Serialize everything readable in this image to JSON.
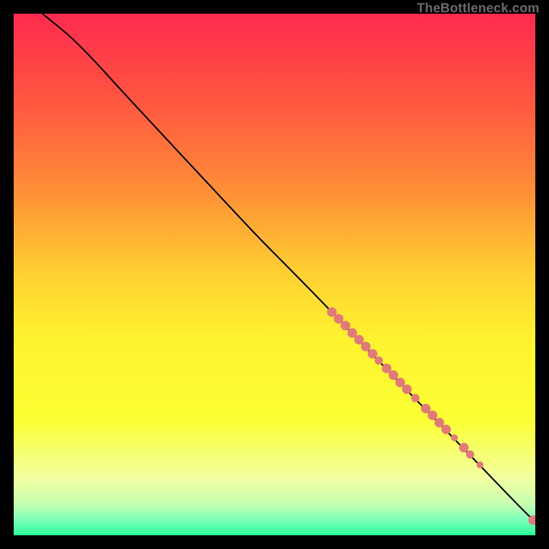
{
  "attribution": "TheBottleneck.com",
  "chart_data": {
    "type": "line",
    "title": "",
    "xlabel": "",
    "ylabel": "",
    "xlim": [
      0,
      1
    ],
    "ylim": [
      0,
      1
    ],
    "background": {
      "type": "vertical-gradient",
      "stops": [
        {
          "pos": 0.0,
          "color": "#ff2a4f"
        },
        {
          "pos": 0.17,
          "color": "#ff5740"
        },
        {
          "pos": 0.34,
          "color": "#ff8f36"
        },
        {
          "pos": 0.5,
          "color": "#ffd131"
        },
        {
          "pos": 0.62,
          "color": "#fff22f"
        },
        {
          "pos": 0.78,
          "color": "#fbff33"
        },
        {
          "pos": 0.89,
          "color": "#f2ffa0"
        },
        {
          "pos": 0.94,
          "color": "#c6ffb0"
        },
        {
          "pos": 0.97,
          "color": "#7dffb9"
        },
        {
          "pos": 1.0,
          "color": "#2cff9a"
        }
      ]
    },
    "curve": [
      {
        "x": 0.055,
        "y": 1.0
      },
      {
        "x": 0.08,
        "y": 0.98
      },
      {
        "x": 0.11,
        "y": 0.955
      },
      {
        "x": 0.15,
        "y": 0.915
      },
      {
        "x": 0.2,
        "y": 0.86
      },
      {
        "x": 0.26,
        "y": 0.795
      },
      {
        "x": 0.33,
        "y": 0.72
      },
      {
        "x": 0.4,
        "y": 0.645
      },
      {
        "x": 0.47,
        "y": 0.57
      },
      {
        "x": 0.54,
        "y": 0.5
      },
      {
        "x": 0.61,
        "y": 0.428
      },
      {
        "x": 0.68,
        "y": 0.355
      },
      {
        "x": 0.75,
        "y": 0.282
      },
      {
        "x": 0.82,
        "y": 0.21
      },
      {
        "x": 0.89,
        "y": 0.138
      },
      {
        "x": 0.96,
        "y": 0.065
      },
      {
        "x": 1.0,
        "y": 0.025
      }
    ],
    "marker_color": "#e27a7a",
    "markers": [
      {
        "x": 0.61,
        "y": 0.428,
        "r": 7
      },
      {
        "x": 0.623,
        "y": 0.415,
        "r": 7
      },
      {
        "x": 0.636,
        "y": 0.402,
        "r": 7
      },
      {
        "x": 0.649,
        "y": 0.388,
        "r": 7
      },
      {
        "x": 0.662,
        "y": 0.375,
        "r": 7
      },
      {
        "x": 0.675,
        "y": 0.362,
        "r": 7
      },
      {
        "x": 0.688,
        "y": 0.348,
        "r": 7
      },
      {
        "x": 0.7,
        "y": 0.335,
        "r": 6
      },
      {
        "x": 0.715,
        "y": 0.32,
        "r": 7
      },
      {
        "x": 0.728,
        "y": 0.307,
        "r": 7
      },
      {
        "x": 0.741,
        "y": 0.293,
        "r": 7
      },
      {
        "x": 0.754,
        "y": 0.28,
        "r": 7
      },
      {
        "x": 0.77,
        "y": 0.263,
        "r": 6
      },
      {
        "x": 0.79,
        "y": 0.243,
        "r": 7
      },
      {
        "x": 0.803,
        "y": 0.23,
        "r": 7
      },
      {
        "x": 0.816,
        "y": 0.216,
        "r": 7
      },
      {
        "x": 0.829,
        "y": 0.203,
        "r": 7
      },
      {
        "x": 0.845,
        "y": 0.187,
        "r": 5
      },
      {
        "x": 0.863,
        "y": 0.168,
        "r": 7
      },
      {
        "x": 0.875,
        "y": 0.155,
        "r": 6
      },
      {
        "x": 0.894,
        "y": 0.135,
        "r": 5
      },
      {
        "x": 0.996,
        "y": 0.029,
        "r": 7
      }
    ]
  }
}
